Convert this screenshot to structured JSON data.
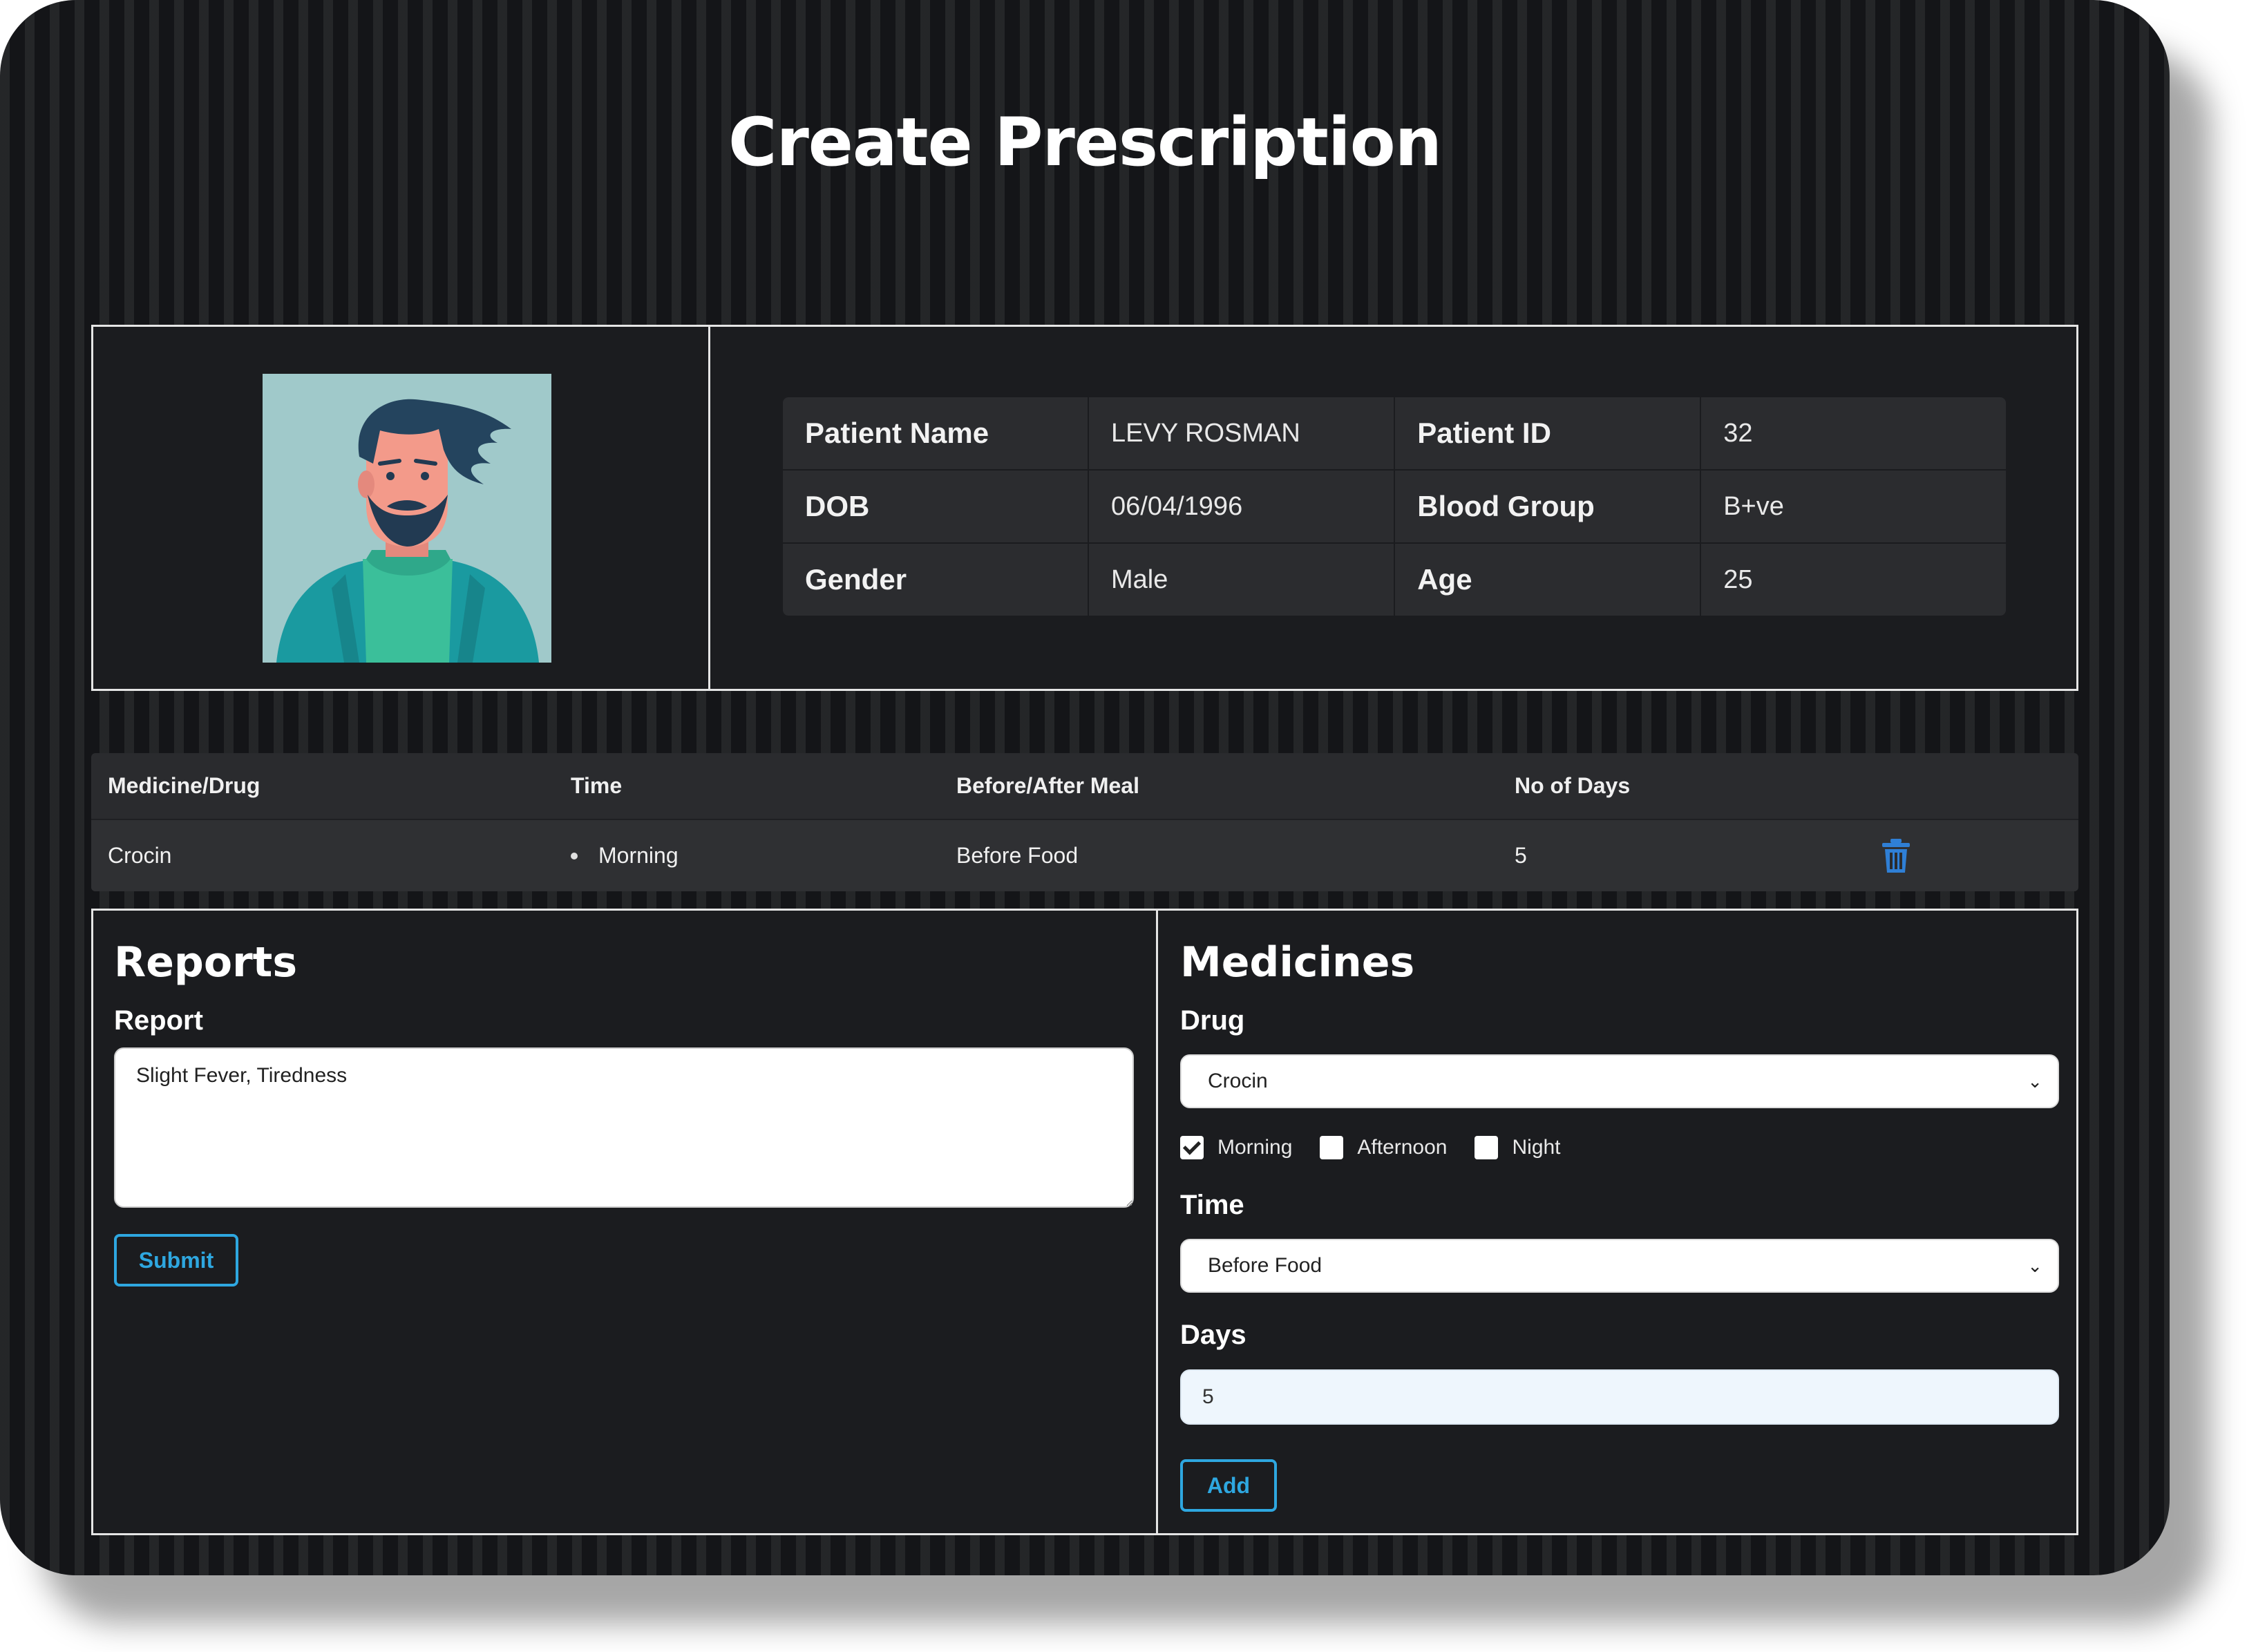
{
  "page": {
    "title": "Create Prescription"
  },
  "patient": {
    "rows": [
      {
        "label1": "Patient Name",
        "value1": "LEVY ROSMAN",
        "label2": "Patient ID",
        "value2": "32"
      },
      {
        "label1": "DOB",
        "value1": "06/04/1996",
        "label2": "Blood Group",
        "value2": "B+ve"
      },
      {
        "label1": "Gender",
        "value1": "Male",
        "label2": "Age",
        "value2": "25"
      }
    ]
  },
  "medicine_table": {
    "headers": [
      "Medicine/Drug",
      "Time",
      "Before/After Meal",
      "No of Days"
    ],
    "rows": [
      {
        "drug": "Crocin",
        "time": [
          "Morning"
        ],
        "meal": "Before Food",
        "days": "5",
        "action_icon": "trash-icon"
      }
    ]
  },
  "reports": {
    "title": "Reports",
    "report_label": "Report",
    "report_value": "Slight Fever, Tiredness",
    "submit_label": "Submit"
  },
  "medicines": {
    "title": "Medicines",
    "drug_label": "Drug",
    "drug_selected": "Crocin",
    "time_options": [
      {
        "label": "Morning",
        "checked": true
      },
      {
        "label": "Afternoon",
        "checked": false
      },
      {
        "label": "Night",
        "checked": false
      }
    ],
    "time_label": "Time",
    "time_selected": "Before Food",
    "days_label": "Days",
    "days_value": "5",
    "add_label": "Add"
  },
  "colors": {
    "accent": "#2ea7e0",
    "background": "#141518",
    "panel": "#1b1c1f",
    "table": "#2b2c2f"
  }
}
